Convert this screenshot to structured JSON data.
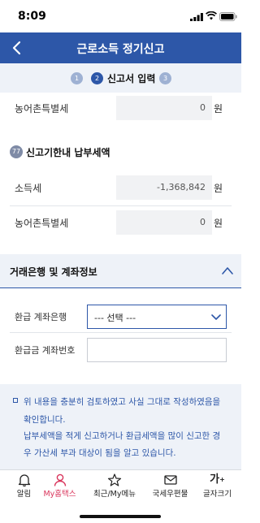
{
  "status": {
    "time": "8:09"
  },
  "header": {
    "title": "근로소득 정기신고"
  },
  "steps": {
    "items": [
      {
        "num": "1"
      },
      {
        "num": "2",
        "label": "신고서 입력"
      },
      {
        "num": "3"
      }
    ]
  },
  "rows_top": [
    {
      "label": "농어촌특별세",
      "value": "0",
      "unit": "원"
    }
  ],
  "section77": {
    "num": "77",
    "title": "신고기한내 납부세액",
    "rows": [
      {
        "label": "소득세",
        "value": "-1,368,842",
        "unit": "원"
      },
      {
        "label": "농어촌특별세",
        "value": "0",
        "unit": "원"
      }
    ]
  },
  "bank": {
    "title": "거래은행 및 계좌정보",
    "bank_label": "환급 계좌은행",
    "bank_select_value": "--- 선택 ---",
    "account_label": "환급금 계좌번호",
    "account_value": ""
  },
  "notice": {
    "lines": [
      "위 내용을 충분히 검토하였고 사실 그대로 작성하였음을",
      "확인합니다.",
      "납부세액을 적게 신고하거나 환급세액을 많이 신고한 경",
      "우 가산세 부과 대상이 됨을 알고 있습니다."
    ]
  },
  "tabbar": {
    "items": [
      {
        "label": "알림",
        "icon": "bell-icon",
        "active": false
      },
      {
        "label": "My홈택스",
        "icon": "person-icon",
        "active": true
      },
      {
        "label": "최근/My메뉴",
        "icon": "star-icon",
        "active": false
      },
      {
        "label": "국세우편물",
        "icon": "mail-icon",
        "active": false
      },
      {
        "label": "글자크기",
        "icon": "font-size-icon",
        "icon_text": "가",
        "active": false
      }
    ]
  },
  "colors": {
    "brand": "#2d57a8",
    "active_tab": "#d9345b"
  }
}
